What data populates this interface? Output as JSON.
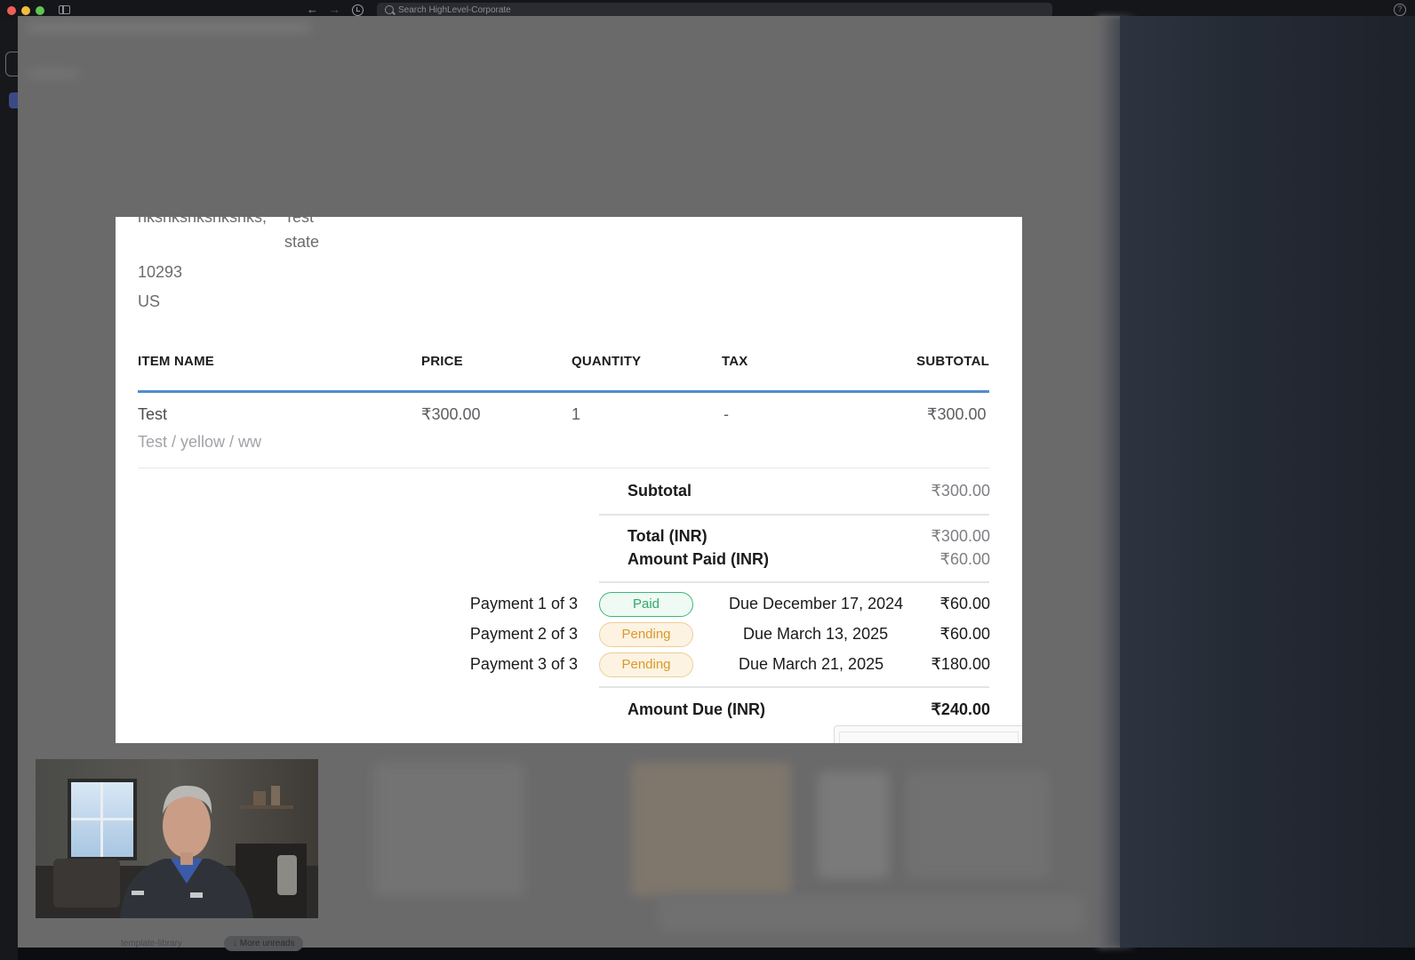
{
  "browser": {
    "search_placeholder": "Search HighLevel-Corporate",
    "help_symbol": "?"
  },
  "invoice": {
    "address": {
      "line_partial_left": "nksnksnksnksnks,",
      "line_partial_right": "Test",
      "state": "state",
      "zip": "10293",
      "country": "US"
    },
    "columns": [
      "ITEM NAME",
      "PRICE",
      "QUANTITY",
      "TAX",
      "SUBTOTAL"
    ],
    "items": [
      {
        "name": "Test",
        "variant": "Test / yellow / ww",
        "price": "₹300.00",
        "quantity": "1",
        "tax": "-",
        "subtotal": "₹300.00"
      }
    ],
    "summary": {
      "subtotal_label": "Subtotal",
      "subtotal_value": "₹300.00",
      "total_label": "Total (INR)",
      "total_value": "₹300.00",
      "amount_paid_label": "Amount Paid (INR)",
      "amount_paid_value": "₹60.00"
    },
    "payments": [
      {
        "label": "Payment 1 of 3",
        "status": "Paid",
        "due": "Due December 17, 2024",
        "amount": "₹60.00"
      },
      {
        "label": "Payment 2 of 3",
        "status": "Pending",
        "due": "Due March 13, 2025",
        "amount": "₹60.00"
      },
      {
        "label": "Payment 3 of 3",
        "status": "Pending",
        "due": "Due March 21, 2025",
        "amount": "₹180.00"
      }
    ],
    "amount_due_label": "Amount Due (INR)",
    "amount_due_value": "₹240.00"
  },
  "bottom_bar": {
    "template_library": "template-library",
    "more_unreads": "More unreads"
  },
  "colors": {
    "header_rule": "#4f8fc8",
    "paid": "#2fa86a",
    "pending": "#d99a28"
  }
}
